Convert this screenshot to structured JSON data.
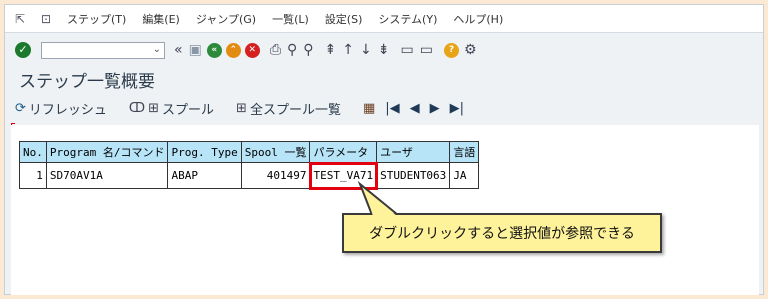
{
  "menubar": {
    "items": [
      "ステップ(T)",
      "編集(E)",
      "ジャンプ(G)",
      "一覧(L)",
      "設定(S)",
      "システム(Y)",
      "ヘルプ(H)"
    ]
  },
  "toolbar": {
    "command_value": ""
  },
  "page": {
    "title": "ステップ一覧概要"
  },
  "app_toolbar": {
    "refresh_label": "リフレッシュ",
    "spool_label": "スプール",
    "all_spool_label": "全スプール一覧"
  },
  "table": {
    "headers": [
      "No.",
      "Program 名/コマンド",
      "Prog. Type",
      "Spool 一覧",
      "パラメータ",
      "ユーザ",
      "言語"
    ],
    "rows": [
      [
        "1",
        "SD70AV1A",
        "ABAP",
        "401497",
        "TEST_VA71",
        "STUDENT063",
        "JA"
      ]
    ]
  },
  "callout": {
    "text": "ダブルクリックすると選択値が参照できる"
  },
  "colors": {
    "header_bg": "#b8e4f8",
    "highlight": "#e3000f",
    "callout_bg": "#fef39a",
    "outer_bg": "#fbe9d4"
  }
}
